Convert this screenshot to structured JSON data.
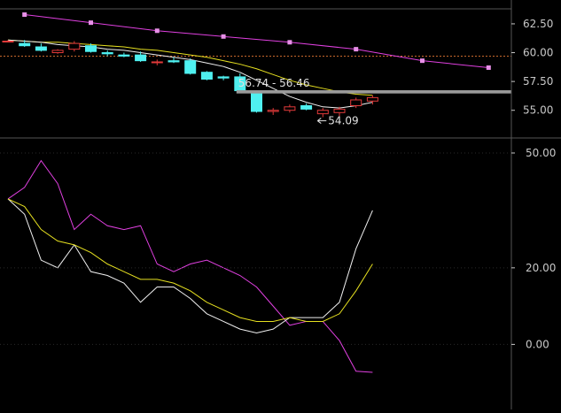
{
  "chart_data": [
    {
      "type": "candlestick",
      "panel": "price",
      "ylim": [
        52.6,
        63.8
      ],
      "y_ticks": [
        "62.50",
        "60.00",
        "57.50",
        "55.00"
      ],
      "tick_values": [
        62.5,
        60.0,
        57.5,
        55.0
      ],
      "reference_line": 59.7,
      "candles": [
        {
          "o": 61.0,
          "h": 61.1,
          "l": 60.9,
          "c": 61.0
        },
        {
          "o": 60.8,
          "h": 61.1,
          "l": 60.5,
          "c": 60.6
        },
        {
          "o": 60.5,
          "h": 60.8,
          "l": 60.1,
          "c": 60.2
        },
        {
          "o": 60.0,
          "h": 60.3,
          "l": 59.9,
          "c": 60.2
        },
        {
          "o": 60.3,
          "h": 61.0,
          "l": 60.1,
          "c": 60.8
        },
        {
          "o": 60.6,
          "h": 60.8,
          "l": 60.0,
          "c": 60.1
        },
        {
          "o": 60.0,
          "h": 60.2,
          "l": 59.7,
          "c": 59.9
        },
        {
          "o": 59.8,
          "h": 60.0,
          "l": 59.6,
          "c": 59.7
        },
        {
          "o": 59.8,
          "h": 60.1,
          "l": 59.2,
          "c": 59.3
        },
        {
          "o": 59.2,
          "h": 59.4,
          "l": 58.9,
          "c": 59.2
        },
        {
          "o": 59.3,
          "h": 59.6,
          "l": 59.1,
          "c": 59.2
        },
        {
          "o": 59.3,
          "h": 59.5,
          "l": 58.1,
          "c": 58.2
        },
        {
          "o": 58.3,
          "h": 58.4,
          "l": 57.6,
          "c": 57.7
        },
        {
          "o": 57.9,
          "h": 58.0,
          "l": 57.6,
          "c": 57.8
        },
        {
          "o": 57.9,
          "h": 58.2,
          "l": 56.5,
          "c": 56.7
        },
        {
          "o": 56.6,
          "h": 56.7,
          "l": 54.8,
          "c": 54.9
        },
        {
          "o": 54.9,
          "h": 55.2,
          "l": 54.6,
          "c": 55.0
        },
        {
          "o": 55.0,
          "h": 55.5,
          "l": 54.8,
          "c": 55.3
        },
        {
          "o": 55.4,
          "h": 55.6,
          "l": 55.0,
          "c": 55.1
        },
        {
          "o": 54.7,
          "h": 55.2,
          "l": 54.4,
          "c": 55.0
        },
        {
          "o": 54.8,
          "h": 55.3,
          "l": 54.5,
          "c": 55.1
        },
        {
          "o": 55.4,
          "h": 56.1,
          "l": 55.2,
          "c": 55.9
        },
        {
          "o": 55.8,
          "h": 56.3,
          "l": 55.5,
          "c": 56.1
        }
      ],
      "ma_fast": [
        61.1,
        61.0,
        60.9,
        60.7,
        60.6,
        60.5,
        60.3,
        60.2,
        60.0,
        59.8,
        59.6,
        59.4,
        59.1,
        58.8,
        58.3,
        57.6,
        56.9,
        56.2,
        55.7,
        55.3,
        55.2,
        55.4,
        55.7
      ],
      "ma_mid": [
        61.1,
        61.0,
        60.9,
        60.9,
        60.8,
        60.7,
        60.6,
        60.5,
        60.3,
        60.2,
        60.0,
        59.8,
        59.6,
        59.3,
        59.0,
        58.6,
        58.1,
        57.6,
        57.2,
        56.9,
        56.6,
        56.4,
        56.3
      ],
      "ma_slow": {
        "start_index": 1,
        "step": 4,
        "values": [
          63.3,
          62.6,
          61.9,
          61.4,
          60.9,
          60.3,
          59.3,
          58.7
        ]
      },
      "band": {
        "from_index": 14,
        "high": 56.74,
        "low": 56.46,
        "label": "56.74 - 56.46"
      },
      "low_marker": {
        "index": 19,
        "value": 54.09,
        "label": "54.09"
      }
    },
    {
      "type": "line",
      "panel": "oscillator",
      "ylim": [
        -17,
        53
      ],
      "y_ticks": [
        "50.00",
        "20.00",
        "0.00"
      ],
      "tick_values": [
        50,
        20,
        0
      ],
      "series": [
        {
          "color": "#e040e0",
          "values": [
            38,
            41,
            48,
            42,
            30,
            34,
            31,
            30,
            31,
            21,
            19,
            21,
            22,
            20,
            18,
            15,
            10,
            5,
            6,
            6,
            1,
            -7,
            -7.3
          ]
        },
        {
          "color": "#f0f0f0",
          "values": [
            38,
            34,
            22,
            20,
            26,
            19,
            18,
            16,
            11,
            15,
            15,
            12,
            8,
            6,
            4,
            3,
            4,
            7,
            7,
            7,
            11,
            25,
            35
          ]
        },
        {
          "color": "#e6e020",
          "values": [
            38,
            36,
            30,
            27,
            26,
            24,
            21,
            19,
            17,
            17,
            16,
            14,
            11,
            9,
            7,
            6,
            6,
            7,
            6,
            6,
            8,
            14,
            21
          ]
        }
      ]
    }
  ],
  "colors": {
    "background": "#000000",
    "bull": "#e23a3a",
    "bear": "#4ff0f0",
    "ma_fast": "#f0f0f0",
    "ma_mid": "#e6e020",
    "ma_slow": "#e040e0",
    "reference": "#c8682c",
    "band": "#9a9a9a",
    "axis": "#555555",
    "label": "#c8c8c8"
  }
}
